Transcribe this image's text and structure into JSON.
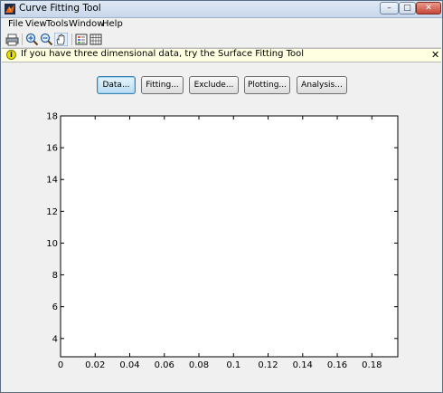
{
  "window": {
    "title": "Curve Fitting Tool"
  },
  "menu": [
    "File",
    "View",
    "Tools",
    "Window",
    "Help"
  ],
  "toolbar": {
    "icons": [
      "print-icon",
      "zoom-in-icon",
      "zoom-out-icon",
      "pan-hand-icon",
      "legend-icon",
      "grid-icon"
    ]
  },
  "infobar": {
    "message": "If you have three dimensional data, try the Surface Fitting Tool",
    "close_glyph": "✕"
  },
  "buttons": [
    "Data...",
    "Fitting...",
    "Exclude...",
    "Plotting...",
    "Analysis..."
  ],
  "colors": {
    "active_button": "#b8dcf3",
    "infobar_bg": "#ffffe1",
    "title_gradient": "#c7d7ea"
  },
  "chart_data": {
    "type": "scatter",
    "title": "",
    "xlabel": "",
    "ylabel": "",
    "xlim": [
      0,
      0.195
    ],
    "ylim": [
      2.85,
      18
    ],
    "xticks": [
      "0",
      "0.02",
      "0.04",
      "0.06",
      "0.08",
      "0.1",
      "0.12",
      "0.14",
      "0.16",
      "0.18"
    ],
    "yticks": [
      "4",
      "6",
      "8",
      "10",
      "12",
      "14",
      "16",
      "18"
    ],
    "grid": false,
    "series": []
  }
}
